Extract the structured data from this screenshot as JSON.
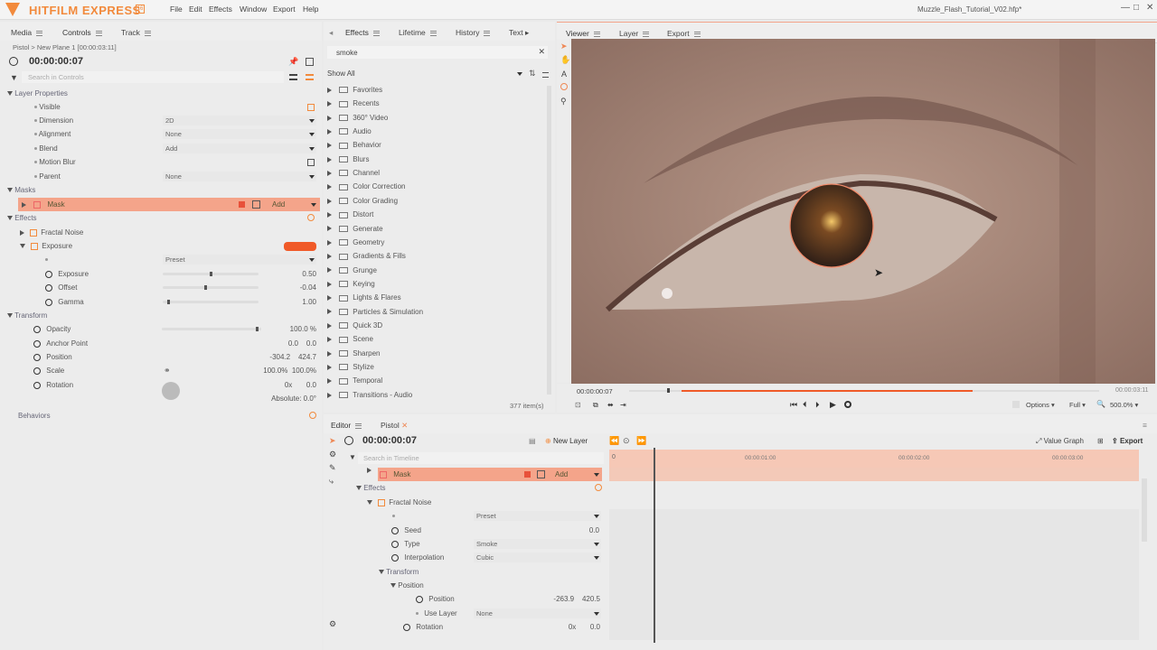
{
  "app": {
    "name": "HITFILM EXPRESS",
    "badge": "16",
    "file_title": "Muzzle_Flash_Tutorial_V02.hfp*",
    "menus": [
      "File",
      "Edit",
      "Effects",
      "Window",
      "Export",
      "Help"
    ],
    "win_buttons": [
      "—",
      "□",
      "✕"
    ]
  },
  "left": {
    "tabs": [
      "Media",
      "Controls",
      "Track"
    ],
    "layer_path": "Pistol > New Plane 1 [00:00:03:11]",
    "time": "00:00:00:07",
    "search_placeholder": "Search in Controls",
    "layer_props_title": "Layer Properties",
    "props": [
      {
        "label": "Visible",
        "value": ""
      },
      {
        "label": "Dimension",
        "value": "2D"
      },
      {
        "label": "Alignment",
        "value": "None"
      },
      {
        "label": "Blend",
        "value": "Add"
      },
      {
        "label": "Motion Blur",
        "value": ""
      },
      {
        "label": "Parent",
        "value": "None"
      }
    ],
    "masks_title": "Masks",
    "mask_label": "Mask",
    "mask_mode": "Add",
    "effects_title": "Effects",
    "effect1": "Fractal Noise",
    "effect2": "Exposure",
    "preset_label": "Preset",
    "exposure_params": [
      {
        "label": "Exposure",
        "value": "0.50",
        "pos": 0.5
      },
      {
        "label": "Offset",
        "value": "-0.04",
        "pos": 0.45
      },
      {
        "label": "Gamma",
        "value": "1.00",
        "pos": 0.05
      }
    ],
    "transform_title": "Transform",
    "transform": [
      {
        "label": "Opacity",
        "value": "100.0 %"
      },
      {
        "label": "Anchor Point",
        "value": "0.0    0.0"
      },
      {
        "label": "Position",
        "value": "-304.2    424.7"
      },
      {
        "label": "Scale",
        "value": "100.0%  100.0%"
      },
      {
        "label": "Rotation",
        "value": "0x       0.0"
      }
    ],
    "absolute": "Absolute: 0.0°",
    "behaviors": "Behaviors"
  },
  "effects_panel": {
    "tabs": [
      "Effects",
      "Lifetime",
      "History",
      "Text"
    ],
    "search_value": "smoke",
    "filter": "Show All",
    "count": "377 item(s)",
    "folders": [
      "Favorites",
      "Recents",
      "360° Video",
      "Audio",
      "Behavior",
      "Blurs",
      "Channel",
      "Color Correction",
      "Color Grading",
      "Distort",
      "Generate",
      "Geometry",
      "Gradients & Fills",
      "Grunge",
      "Keying",
      "Lights & Flares",
      "Particles & Simulation",
      "Quick 3D",
      "Scene",
      "Sharpen",
      "Stylize",
      "Temporal",
      "Transitions - Audio"
    ]
  },
  "viewer": {
    "tabs": [
      "Viewer",
      "Layer",
      "Export"
    ],
    "time_left": "00:00:00:07",
    "time_right": "00:00:03:11",
    "options": "Options",
    "full": "Full",
    "zoom": "500.0%"
  },
  "editor": {
    "tabs": [
      "Editor",
      "Pistol"
    ],
    "time": "00:00:00:07",
    "new_layer": "New Layer",
    "search_placeholder": "Search in Timeline",
    "value_graph": "Value Graph",
    "export": "Export",
    "ruler": [
      "00:00:01:00",
      "00:00:02:00",
      "00:00:03:00"
    ],
    "mask": "Mask",
    "mask_mode": "Add",
    "effects": "Effects",
    "fractal": "Fractal Noise",
    "preset": "Preset",
    "params": [
      {
        "label": "Seed",
        "value": "0.0"
      },
      {
        "label": "Type",
        "value": "Smoke"
      },
      {
        "label": "Interpolation",
        "value": "Cubic"
      }
    ],
    "transform": "Transform",
    "position_group": "Position",
    "position": {
      "label": "Position",
      "value": "-263.9    420.5"
    },
    "use_layer": {
      "label": "Use Layer",
      "value": "None"
    },
    "rotation": {
      "label": "Rotation",
      "value": "0x       0.0"
    }
  }
}
